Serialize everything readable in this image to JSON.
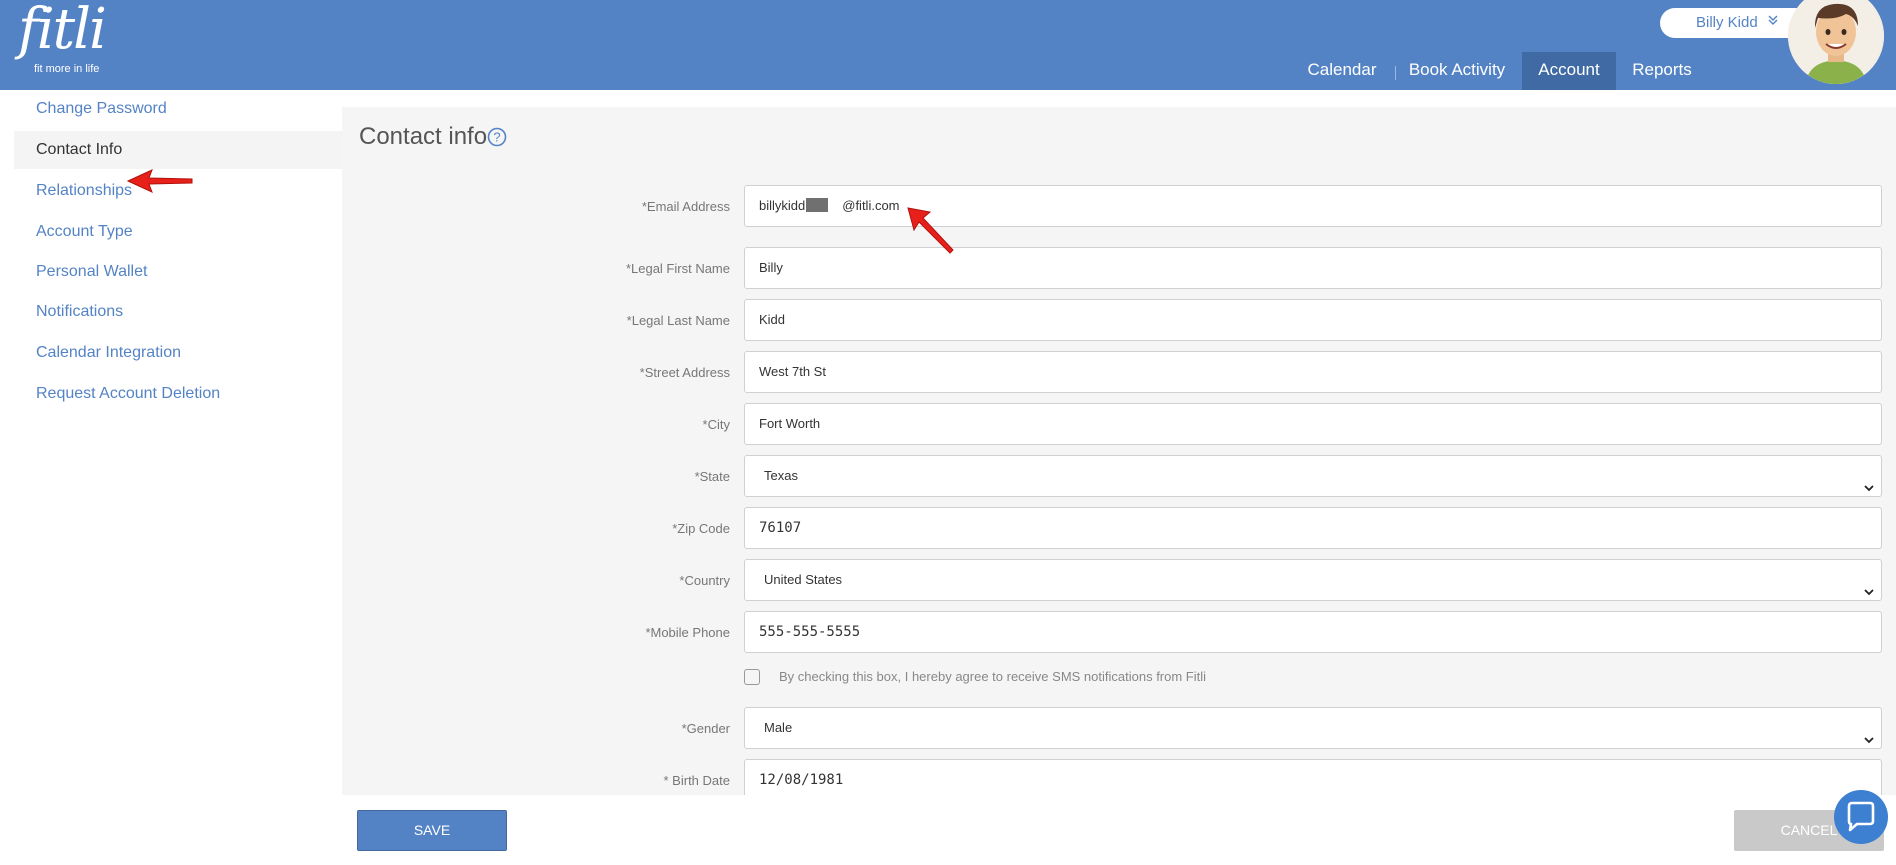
{
  "header": {
    "logo_word": "fitli",
    "logo_tagline": "fit more in life",
    "user_name": "Billy Kidd",
    "user_menu_icon": "double-chevron-down-icon",
    "avatar_icon": "avatar"
  },
  "nav": {
    "items": [
      {
        "label": "Calendar",
        "active": false
      },
      {
        "label": "Book Activity",
        "active": false
      },
      {
        "label": "Account",
        "active": true
      },
      {
        "label": "Reports",
        "active": false
      }
    ]
  },
  "sidebar": {
    "items": [
      {
        "label": "Change Password",
        "active": false
      },
      {
        "label": "Contact Info",
        "active": true
      },
      {
        "label": "Relationships",
        "active": false
      },
      {
        "label": "Account Type",
        "active": false
      },
      {
        "label": "Personal Wallet",
        "active": false
      },
      {
        "label": "Notifications",
        "active": false
      },
      {
        "label": "Calendar Integration",
        "active": false
      },
      {
        "label": "Request Account Deletion",
        "active": false
      }
    ]
  },
  "main": {
    "title": "Contact info",
    "help_icon": "question-circle-icon",
    "fields": [
      {
        "label": "*Email Address",
        "value_prefix": "billykidd",
        "value_suffix": "@fitli.com",
        "type": "text"
      },
      {
        "label": "*Legal First Name",
        "value": "Billy",
        "type": "text"
      },
      {
        "label": "*Legal Last Name",
        "value": "Kidd",
        "type": "text"
      },
      {
        "label": "*Street Address",
        "value": "West 7th St",
        "type": "text"
      },
      {
        "label": "*City",
        "value": "Fort Worth",
        "type": "text"
      },
      {
        "label": "*State",
        "value": "Texas",
        "type": "select"
      },
      {
        "label": "*Zip Code",
        "value": "76107",
        "type": "text"
      },
      {
        "label": "*Country",
        "value": "United States",
        "type": "select"
      },
      {
        "label": "*Mobile Phone",
        "value": "555-555-5555",
        "type": "text"
      },
      {
        "label": "*Gender",
        "value": "Male",
        "type": "select"
      },
      {
        "label": "* Birth Date",
        "value": "12/08/1981",
        "type": "text"
      }
    ],
    "sms_consent": {
      "label": "By checking this box, I hereby agree to receive SMS notifications from Fitli",
      "checked": false
    }
  },
  "footer": {
    "save_label": "SAVE",
    "cancel_label": "CANCEL",
    "chat_icon": "chat-bubble-icon"
  },
  "colors": {
    "brand": "#5483c5",
    "nav_active": "#3f6aa3",
    "panel_bg": "#f5f5f5",
    "annotation_arrow": "#e8201a"
  }
}
